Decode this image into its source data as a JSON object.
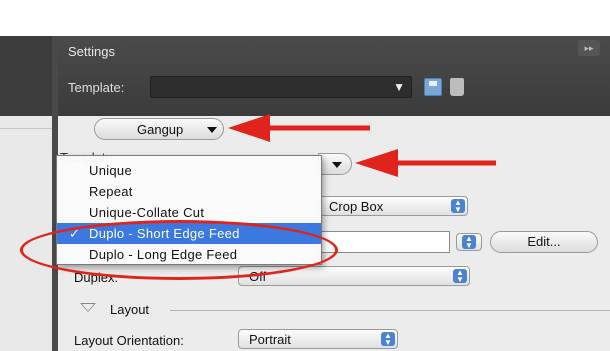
{
  "panel": {
    "title": "Settings",
    "collapse_glyph": "▸▸",
    "template_label": "Template:",
    "template_value": ""
  },
  "controls": {
    "gangup_label": "Gangup",
    "template2_label": "Template:",
    "page_box_value": "Crop Box",
    "edit_label": "Edit...",
    "duplex_label": "Duplex:",
    "duplex_value": "Off",
    "layout_label": "Layout",
    "orientation_label": "Layout Orientation:",
    "orientation_value": "Portrait"
  },
  "menu": {
    "items": [
      {
        "label": "Unique",
        "selected": false
      },
      {
        "label": "Repeat",
        "selected": false
      },
      {
        "label": "Unique-Collate Cut",
        "selected": false
      },
      {
        "label": "Duplo - Short Edge Feed",
        "selected": true
      },
      {
        "label": "Duplo - Long Edge Feed",
        "selected": false
      }
    ],
    "check_glyph": "✓"
  },
  "icons": {
    "save": "save-icon",
    "trash": "trash-icon",
    "dropdown": "chevron-down-icon",
    "stepper": "stepper-icon",
    "disclosure": "disclosure-triangle-icon"
  },
  "colors": {
    "annotation_red": "#e0241c",
    "selection_blue": "#3b78e0",
    "panel_dark": "#3b3b3b"
  }
}
